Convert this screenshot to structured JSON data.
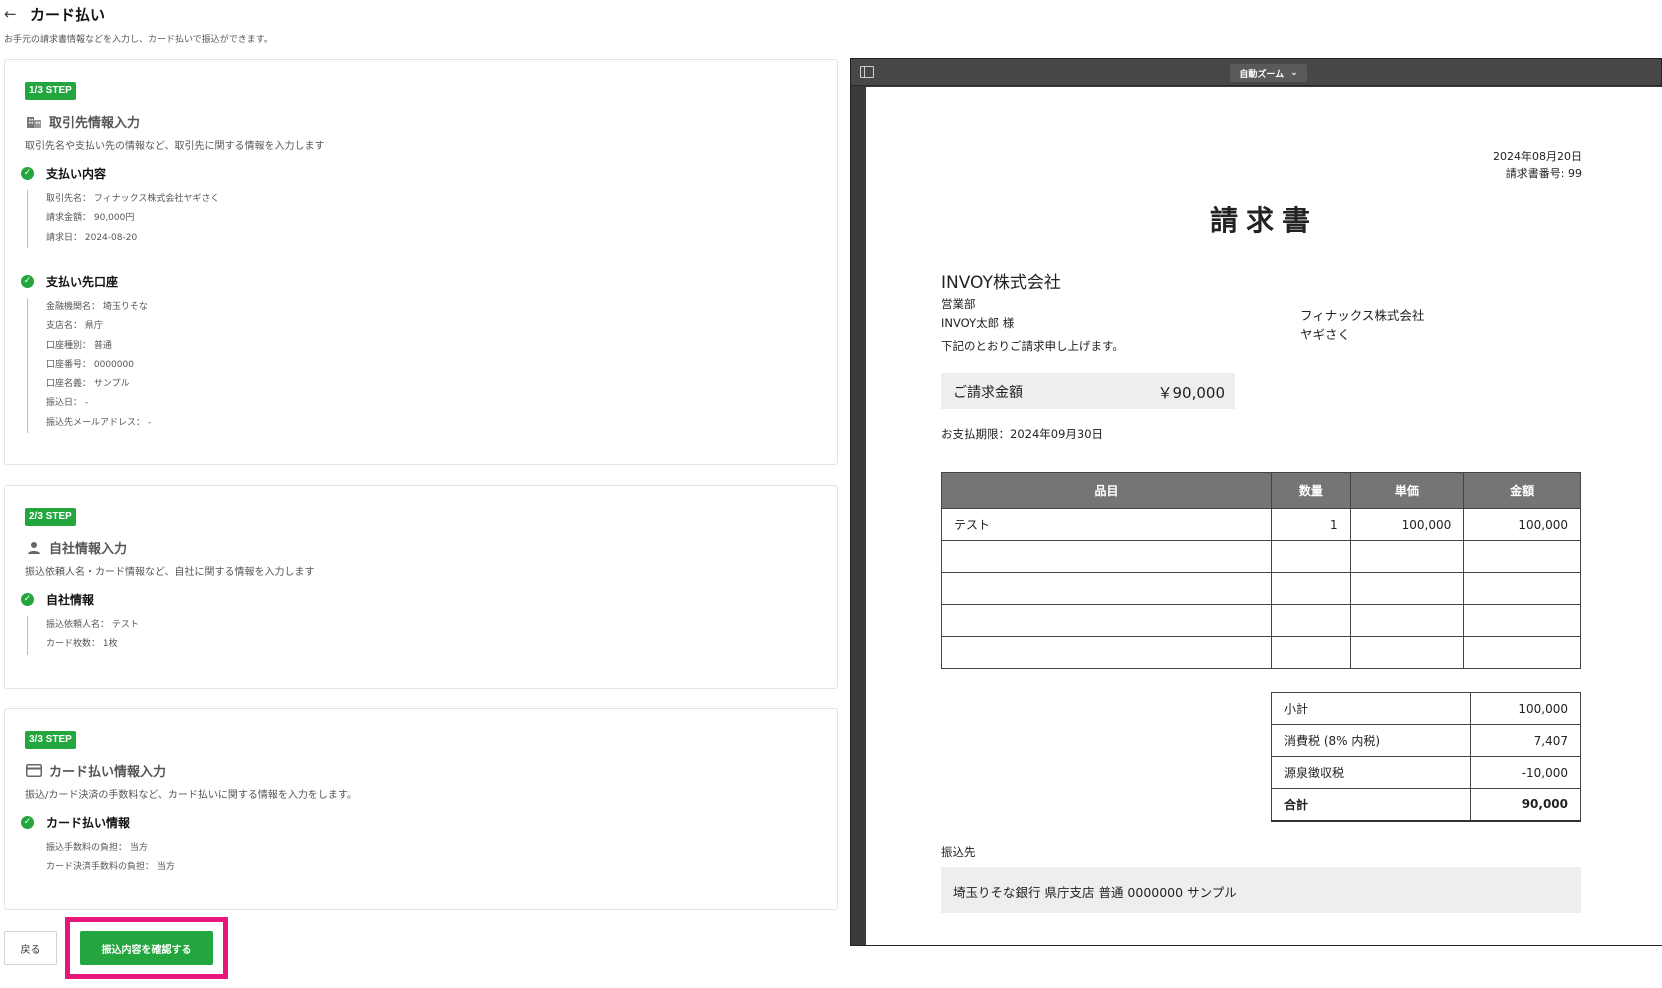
{
  "header": {
    "back_icon": "arrow-left-icon",
    "title": "カード払い",
    "subtitle": "お手元の請求書情報などを入力し、カード払いで振込ができます。"
  },
  "steps": [
    {
      "badge": "1/3 STEP",
      "icon": "building-icon",
      "title": "取引先情報入力",
      "description": "取引先名や支払い先の情報など、取引先に関する情報を入力します",
      "sections": [
        {
          "title": "支払い内容",
          "lines": [
            "取引先名： フィナックス株式会社ヤギさく",
            "請求金額： 90,000円",
            "請求日： 2024-08-20"
          ]
        },
        {
          "title": "支払い先口座",
          "lines": [
            "金融機関名： 埼玉りそな",
            "支店名： 県庁",
            "口座種別： 普通",
            "口座番号： 0000000",
            "口座名義： サンプル",
            "振込日： -",
            "振込先メールアドレス： -"
          ]
        }
      ]
    },
    {
      "badge": "2/3 STEP",
      "icon": "person-icon",
      "title": "自社情報入力",
      "description": "振込依頼人名・カード情報など、自社に関する情報を入力します",
      "sections": [
        {
          "title": "自社情報",
          "lines": [
            "振込依頼人名： テスト",
            "カード枚数： 1枚"
          ]
        }
      ]
    },
    {
      "badge": "3/3 STEP",
      "icon": "credit-card-icon",
      "title": "カード払い情報入力",
      "description": "振込/カード決済の手数料など、カード払いに関する情報を入力をします。",
      "sections": [
        {
          "title": "カード払い情報",
          "lines": [
            "振込手数料の負担： 当方",
            "カード決済手数料の負担： 当方"
          ]
        }
      ]
    }
  ],
  "actions": {
    "back_label": "戻る",
    "confirm_label": "振込内容を確認する",
    "highlight_color": "#e6177a",
    "accent_color": "#22a63d"
  },
  "viewer": {
    "zoom_label": "自動ズーム",
    "invoice": {
      "date": "2024年08月20日",
      "number": "請求書番号: 99",
      "title": "請求書",
      "recipient_company": "INVOY株式会社",
      "recipient_dept": "営業部",
      "recipient_person": "INVOY太郎 様",
      "message": "下記のとおりご請求申し上げます。",
      "sender_company": "フィナックス株式会社",
      "sender_name": "ヤギさく",
      "amount_label": "ご請求金額",
      "amount_value": "￥90,000",
      "due": "お支払期限：2024年09月30日",
      "table_headers": [
        "品目",
        "数量",
        "単価",
        "金額"
      ],
      "rows": [
        [
          "テスト",
          "1",
          "100,000",
          "100,000"
        ],
        [
          "",
          "",
          "",
          ""
        ],
        [
          "",
          "",
          "",
          ""
        ],
        [
          "",
          "",
          "",
          ""
        ],
        [
          "",
          "",
          "",
          ""
        ]
      ],
      "totals": [
        {
          "label": "小計",
          "value": "100,000"
        },
        {
          "label": "消費税 (8% 内税)",
          "value": "7,407"
        },
        {
          "label": "源泉徴収税",
          "value": "-10,000"
        },
        {
          "label": "合計",
          "value": "90,000"
        }
      ],
      "bank_label": "振込先",
      "bank_text": "埼玉りそな銀行 県庁支店 普通 0000000 サンプル"
    }
  }
}
